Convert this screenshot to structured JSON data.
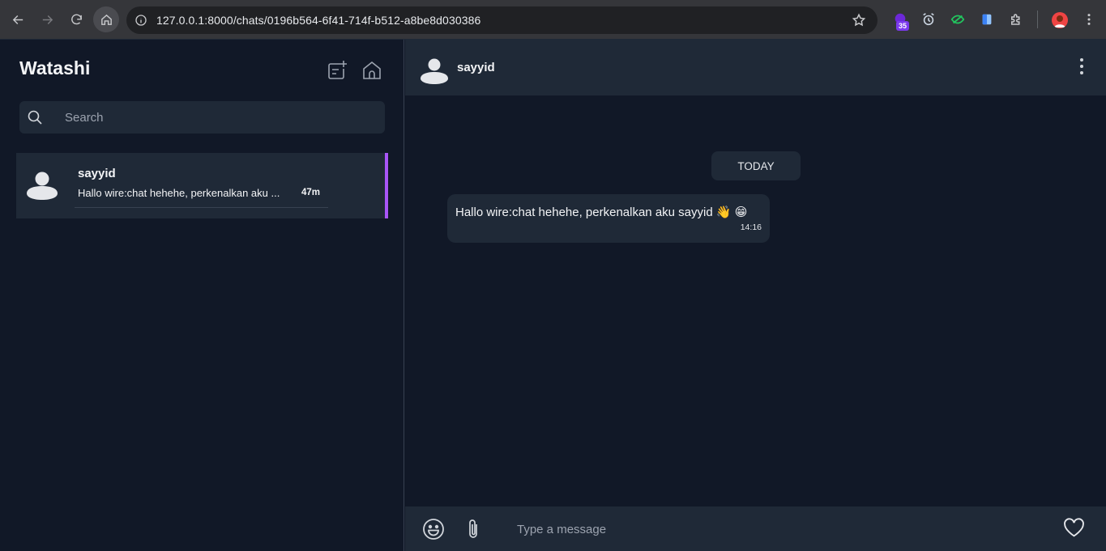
{
  "browser": {
    "url": "127.0.0.1:8000/chats/0196b564-6f41-714f-b512-a8be8d030386",
    "extension_badge": "35"
  },
  "sidebar": {
    "title": "Watashi",
    "search_placeholder": "Search",
    "chats": [
      {
        "name": "sayyid",
        "preview": "Hallo wire:chat hehehe, perkenalkan aku ...",
        "time": "47m"
      }
    ]
  },
  "conversation": {
    "contact_name": "sayyid",
    "date_label": "TODAY",
    "messages": [
      {
        "text": "Hallo wire:chat hehehe, perkenalkan aku sayyid 👋 😁",
        "time": "14:16"
      }
    ],
    "composer_placeholder": "Type a message"
  },
  "colors": {
    "accent": "#a855f7",
    "panel": "#1f2937",
    "background": "#111827"
  }
}
